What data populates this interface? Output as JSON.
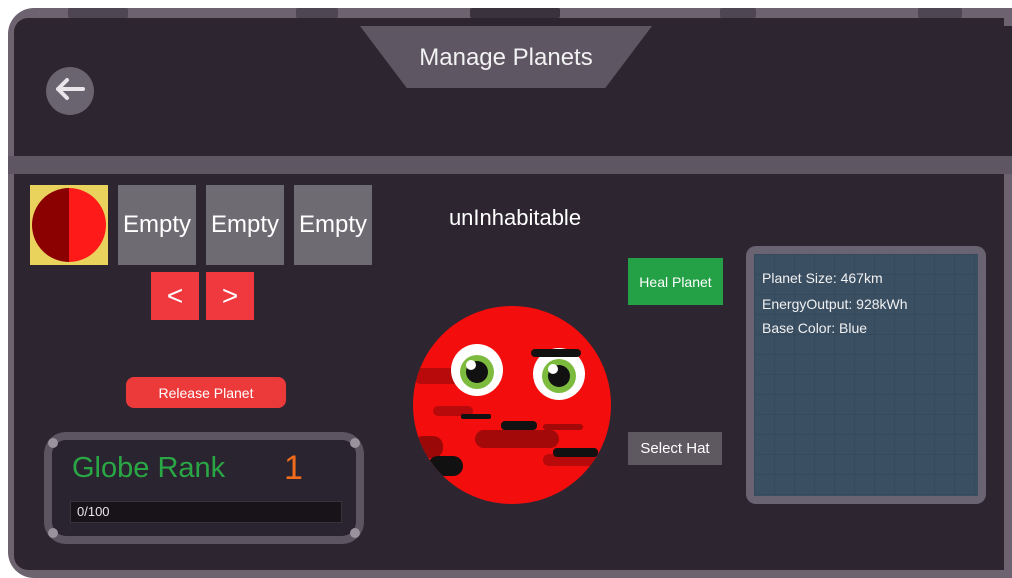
{
  "header": {
    "title": "Manage Planets"
  },
  "slots": [
    {
      "kind": "planet",
      "label": "",
      "colors": [
        "#8b0000",
        "#ff1a1a"
      ]
    },
    {
      "kind": "empty",
      "label": "Empty"
    },
    {
      "kind": "empty",
      "label": "Empty"
    },
    {
      "kind": "empty",
      "label": "Empty"
    }
  ],
  "nav": {
    "prev_label": "<",
    "next_label": ">"
  },
  "release_label": "Release Planet",
  "rank": {
    "label": "Globe Rank",
    "value": "1",
    "progress_text": "0/100",
    "progress_fraction": 0
  },
  "planet": {
    "status": "unInhabitable",
    "color": "#f40d0d",
    "face": "grumpy"
  },
  "actions": {
    "heal_label": "Heal Planet",
    "hat_label": "Select Hat"
  },
  "stats": [
    {
      "text": "Planet Size: 467km"
    },
    {
      "text": "EnergyOutput: 928kWh"
    },
    {
      "text": "Base Color: Blue"
    }
  ],
  "colors": {
    "accent_red": "#f0393e",
    "heal_green": "#24a146",
    "rank_green": "#2aa745",
    "rank_orange": "#f06c1a",
    "selected_slot": "#e9d35d"
  },
  "icons": {
    "back": "back-arrow-icon"
  }
}
